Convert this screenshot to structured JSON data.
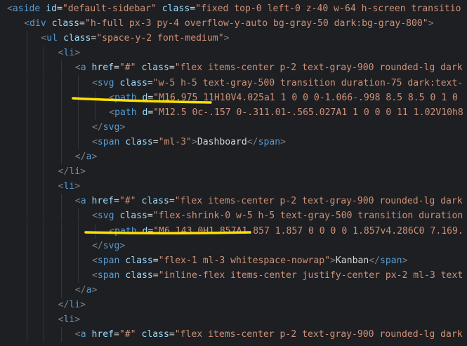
{
  "colors": {
    "background": "#1e1f22",
    "punctuation": "#808080",
    "tag": "#569cd6",
    "attribute": "#9cdcfe",
    "string": "#ce9178",
    "text": "#d4d4d4",
    "equals": "#d4d4d4",
    "annotation": "#ffe000"
  },
  "lines": [
    {
      "indent": 0,
      "tokens": [
        {
          "t": "<",
          "k": "p"
        },
        {
          "t": "aside",
          "k": "tag"
        },
        {
          "t": " ",
          "k": "x"
        },
        {
          "t": "id",
          "k": "attr"
        },
        {
          "t": "=",
          "k": "eq"
        },
        {
          "t": "\"default-sidebar\"",
          "k": "str"
        },
        {
          "t": " ",
          "k": "x"
        },
        {
          "t": "class",
          "k": "attr"
        },
        {
          "t": "=",
          "k": "eq"
        },
        {
          "t": "\"fixed top-0 left-0 z-40 w-64 h-screen transitio",
          "k": "str"
        }
      ]
    },
    {
      "indent": 1,
      "tokens": [
        {
          "t": "<",
          "k": "p"
        },
        {
          "t": "div",
          "k": "tag"
        },
        {
          "t": " ",
          "k": "x"
        },
        {
          "t": "class",
          "k": "attr"
        },
        {
          "t": "=",
          "k": "eq"
        },
        {
          "t": "\"h-full px-3 py-4 overflow-y-auto bg-gray-50 dark:bg-gray-800\"",
          "k": "str"
        },
        {
          "t": ">",
          "k": "p"
        }
      ]
    },
    {
      "indent": 2,
      "tokens": [
        {
          "t": "<",
          "k": "p"
        },
        {
          "t": "ul",
          "k": "tag"
        },
        {
          "t": " ",
          "k": "x"
        },
        {
          "t": "class",
          "k": "attr"
        },
        {
          "t": "=",
          "k": "eq"
        },
        {
          "t": "\"space-y-2 font-medium\"",
          "k": "str"
        },
        {
          "t": ">",
          "k": "p"
        }
      ]
    },
    {
      "indent": 3,
      "tokens": [
        {
          "t": "<",
          "k": "p"
        },
        {
          "t": "li",
          "k": "tag"
        },
        {
          "t": ">",
          "k": "p"
        }
      ]
    },
    {
      "indent": 4,
      "tokens": [
        {
          "t": "<",
          "k": "p"
        },
        {
          "t": "a",
          "k": "tag"
        },
        {
          "t": " ",
          "k": "x"
        },
        {
          "t": "href",
          "k": "attr"
        },
        {
          "t": "=",
          "k": "eq"
        },
        {
          "t": "\"#\"",
          "k": "str"
        },
        {
          "t": " ",
          "k": "x"
        },
        {
          "t": "class",
          "k": "attr"
        },
        {
          "t": "=",
          "k": "eq"
        },
        {
          "t": "\"flex items-center p-2 text-gray-900 rounded-lg dark",
          "k": "str"
        }
      ]
    },
    {
      "indent": 5,
      "tokens": [
        {
          "t": "<",
          "k": "p"
        },
        {
          "t": "svg",
          "k": "tag"
        },
        {
          "t": " ",
          "k": "x"
        },
        {
          "t": "class",
          "k": "attr"
        },
        {
          "t": "=",
          "k": "eq"
        },
        {
          "t": "\"w-5 h-5 text-gray-500 transition duration-75 dark:text-",
          "k": "str"
        }
      ]
    },
    {
      "indent": 6,
      "tokens": [
        {
          "t": "<",
          "k": "p"
        },
        {
          "t": "path",
          "k": "tag"
        },
        {
          "t": " ",
          "k": "x"
        },
        {
          "t": "d",
          "k": "attr"
        },
        {
          "t": "=",
          "k": "eq"
        },
        {
          "t": "\"M16.975 11H10V4.025a1 1 0 0 0-1.066-.998 8.5 8.5 0 1 0",
          "k": "str"
        }
      ]
    },
    {
      "indent": 6,
      "tokens": [
        {
          "t": "<",
          "k": "p"
        },
        {
          "t": "path",
          "k": "tag"
        },
        {
          "t": " ",
          "k": "x"
        },
        {
          "t": "d",
          "k": "attr"
        },
        {
          "t": "=",
          "k": "eq"
        },
        {
          "t": "\"M12.5 0c-.157 0-.311.01-.565.027A1 1 0 0 0 11 1.02V10h8",
          "k": "str"
        }
      ]
    },
    {
      "indent": 5,
      "tokens": [
        {
          "t": "</",
          "k": "p"
        },
        {
          "t": "svg",
          "k": "tag"
        },
        {
          "t": ">",
          "k": "p"
        }
      ]
    },
    {
      "indent": 5,
      "tokens": [
        {
          "t": "<",
          "k": "p"
        },
        {
          "t": "span",
          "k": "tag"
        },
        {
          "t": " ",
          "k": "x"
        },
        {
          "t": "class",
          "k": "attr"
        },
        {
          "t": "=",
          "k": "eq"
        },
        {
          "t": "\"ml-3\"",
          "k": "str"
        },
        {
          "t": ">",
          "k": "p"
        },
        {
          "t": "Dashboard",
          "k": "text"
        },
        {
          "t": "</",
          "k": "p"
        },
        {
          "t": "span",
          "k": "tag"
        },
        {
          "t": ">",
          "k": "p"
        }
      ]
    },
    {
      "indent": 4,
      "tokens": [
        {
          "t": "</",
          "k": "p"
        },
        {
          "t": "a",
          "k": "tag"
        },
        {
          "t": ">",
          "k": "p"
        }
      ]
    },
    {
      "indent": 3,
      "tokens": [
        {
          "t": "</",
          "k": "p"
        },
        {
          "t": "li",
          "k": "tag"
        },
        {
          "t": ">",
          "k": "p"
        }
      ]
    },
    {
      "indent": 3,
      "tokens": [
        {
          "t": "<",
          "k": "p"
        },
        {
          "t": "li",
          "k": "tag"
        },
        {
          "t": ">",
          "k": "p"
        }
      ]
    },
    {
      "indent": 4,
      "tokens": [
        {
          "t": "<",
          "k": "p"
        },
        {
          "t": "a",
          "k": "tag"
        },
        {
          "t": " ",
          "k": "x"
        },
        {
          "t": "href",
          "k": "attr"
        },
        {
          "t": "=",
          "k": "eq"
        },
        {
          "t": "\"#\"",
          "k": "str"
        },
        {
          "t": " ",
          "k": "x"
        },
        {
          "t": "class",
          "k": "attr"
        },
        {
          "t": "=",
          "k": "eq"
        },
        {
          "t": "\"flex items-center p-2 text-gray-900 rounded-lg dark",
          "k": "str"
        }
      ]
    },
    {
      "indent": 5,
      "tokens": [
        {
          "t": "<",
          "k": "p"
        },
        {
          "t": "svg",
          "k": "tag"
        },
        {
          "t": " ",
          "k": "x"
        },
        {
          "t": "class",
          "k": "attr"
        },
        {
          "t": "=",
          "k": "eq"
        },
        {
          "t": "\"flex-shrink-0 w-5 h-5 text-gray-500 transition duration",
          "k": "str"
        }
      ]
    },
    {
      "indent": 6,
      "tokens": [
        {
          "t": "<",
          "k": "p"
        },
        {
          "t": "path",
          "k": "tag"
        },
        {
          "t": " ",
          "k": "x"
        },
        {
          "t": "d",
          "k": "attr"
        },
        {
          "t": "=",
          "k": "eq"
        },
        {
          "t": "\"M6.143 0H1.857A1.857 1.857 0 0 0 0 1.857v4.286C0 7.169.",
          "k": "str"
        }
      ]
    },
    {
      "indent": 5,
      "tokens": [
        {
          "t": "</",
          "k": "p"
        },
        {
          "t": "svg",
          "k": "tag"
        },
        {
          "t": ">",
          "k": "p"
        }
      ]
    },
    {
      "indent": 5,
      "tokens": [
        {
          "t": "<",
          "k": "p"
        },
        {
          "t": "span",
          "k": "tag"
        },
        {
          "t": " ",
          "k": "x"
        },
        {
          "t": "class",
          "k": "attr"
        },
        {
          "t": "=",
          "k": "eq"
        },
        {
          "t": "\"flex-1 ml-3 whitespace-nowrap\"",
          "k": "str"
        },
        {
          "t": ">",
          "k": "p"
        },
        {
          "t": "Kanban",
          "k": "text"
        },
        {
          "t": "</",
          "k": "p"
        },
        {
          "t": "span",
          "k": "tag"
        },
        {
          "t": ">",
          "k": "p"
        }
      ]
    },
    {
      "indent": 5,
      "tokens": [
        {
          "t": "<",
          "k": "p"
        },
        {
          "t": "span",
          "k": "tag"
        },
        {
          "t": " ",
          "k": "x"
        },
        {
          "t": "class",
          "k": "attr"
        },
        {
          "t": "=",
          "k": "eq"
        },
        {
          "t": "\"inline-flex items-center justify-center px-2 ml-3 text",
          "k": "str"
        }
      ]
    },
    {
      "indent": 4,
      "tokens": [
        {
          "t": "</",
          "k": "p"
        },
        {
          "t": "a",
          "k": "tag"
        },
        {
          "t": ">",
          "k": "p"
        }
      ]
    },
    {
      "indent": 3,
      "tokens": [
        {
          "t": "</",
          "k": "p"
        },
        {
          "t": "li",
          "k": "tag"
        },
        {
          "t": ">",
          "k": "p"
        }
      ]
    },
    {
      "indent": 3,
      "tokens": [
        {
          "t": "<",
          "k": "p"
        },
        {
          "t": "li",
          "k": "tag"
        },
        {
          "t": ">",
          "k": "p"
        }
      ]
    },
    {
      "indent": 4,
      "tokens": [
        {
          "t": "<",
          "k": "p"
        },
        {
          "t": "a",
          "k": "tag"
        },
        {
          "t": " ",
          "k": "x"
        },
        {
          "t": "href",
          "k": "attr"
        },
        {
          "t": "=",
          "k": "eq"
        },
        {
          "t": "\"#\"",
          "k": "str"
        },
        {
          "t": " ",
          "k": "x"
        },
        {
          "t": "class",
          "k": "attr"
        },
        {
          "t": "=",
          "k": "eq"
        },
        {
          "t": "\"flex items-center p-2 text-gray-900 rounded-lg dark",
          "k": "str"
        }
      ]
    }
  ]
}
